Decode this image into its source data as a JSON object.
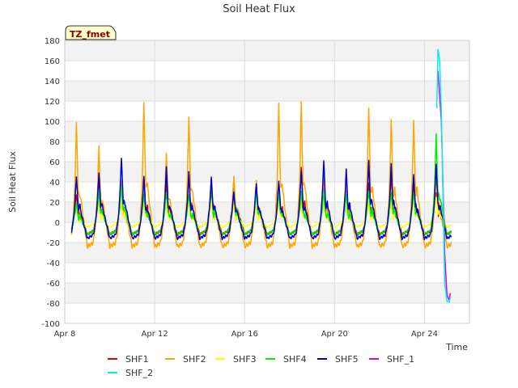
{
  "chart_data": {
    "type": "line",
    "title": "Soil Heat Flux",
    "badge": "TZ_fmet",
    "xlabel": "Time",
    "ylabel": "Soil Heat Flux",
    "ylim": [
      -100,
      180
    ],
    "yticks": [
      -100,
      -80,
      -60,
      -40,
      -20,
      0,
      20,
      40,
      60,
      80,
      100,
      120,
      140,
      160,
      180
    ],
    "xlim_day": [
      8,
      26
    ],
    "xticks": [
      {
        "label": "Apr 8",
        "day": 8
      },
      {
        "label": "Apr 12",
        "day": 12
      },
      {
        "label": "Apr 16",
        "day": 16
      },
      {
        "label": "Apr 20",
        "day": 20
      },
      {
        "label": "Apr 24",
        "day": 24
      }
    ],
    "grid": true,
    "legend_position": "bottom",
    "series": [
      {
        "name": "SHF1",
        "color": "#dd0000",
        "start_day": 8.3,
        "end_day": 25.2,
        "base": -12,
        "peaks": [
          28,
          45,
          40,
          45,
          40,
          48,
          42,
          42,
          35,
          38,
          55,
          40,
          40,
          38,
          48,
          38,
          30
        ]
      },
      {
        "name": "SHF2",
        "color": "#ffa500",
        "start_day": 8.3,
        "end_day": 25.2,
        "base": -24,
        "peaks": [
          97,
          74,
          40,
          119,
          70,
          106,
          44,
          45,
          40,
          116,
          118,
          45,
          42,
          115,
          103,
          101,
          48
        ]
      },
      {
        "name": "SHF3",
        "color": "#ffff00",
        "start_day": 8.3,
        "end_day": 25.2,
        "base": -5,
        "peaks": [
          15,
          20,
          20,
          20,
          20,
          20,
          20,
          18,
          16,
          20,
          20,
          20,
          20,
          20,
          20,
          20,
          25
        ]
      },
      {
        "name": "SHF4",
        "color": "#00ee00",
        "start_day": 8.3,
        "end_day": 25.2,
        "base": -12,
        "peaks": [
          18,
          30,
          37,
          28,
          30,
          28,
          32,
          30,
          30,
          30,
          30,
          30,
          28,
          32,
          30,
          30,
          87
        ]
      },
      {
        "name": "SHF5",
        "color": "#0000cc",
        "start_day": 8.3,
        "end_day": 25.2,
        "base": -16,
        "peaks": [
          46,
          50,
          64,
          45,
          54,
          49,
          44,
          30,
          39,
          42,
          52,
          61,
          52,
          60,
          57,
          47,
          58
        ]
      },
      {
        "name": "SHF_1",
        "color": "#dd00dd",
        "points": [
          [
            24.6,
            150
          ],
          [
            24.75,
            100
          ],
          [
            24.9,
            -30
          ],
          [
            25.0,
            -72
          ],
          [
            25.1,
            -77
          ],
          [
            25.15,
            -70
          ]
        ]
      },
      {
        "name": "SHF_2",
        "color": "#00eeee",
        "points": [
          [
            24.55,
            113
          ],
          [
            24.6,
            171
          ],
          [
            24.68,
            160
          ],
          [
            24.75,
            110
          ],
          [
            24.82,
            30
          ],
          [
            24.9,
            -60
          ],
          [
            25.0,
            -78
          ],
          [
            25.1,
            -79
          ],
          [
            25.15,
            -74
          ]
        ]
      }
    ]
  }
}
